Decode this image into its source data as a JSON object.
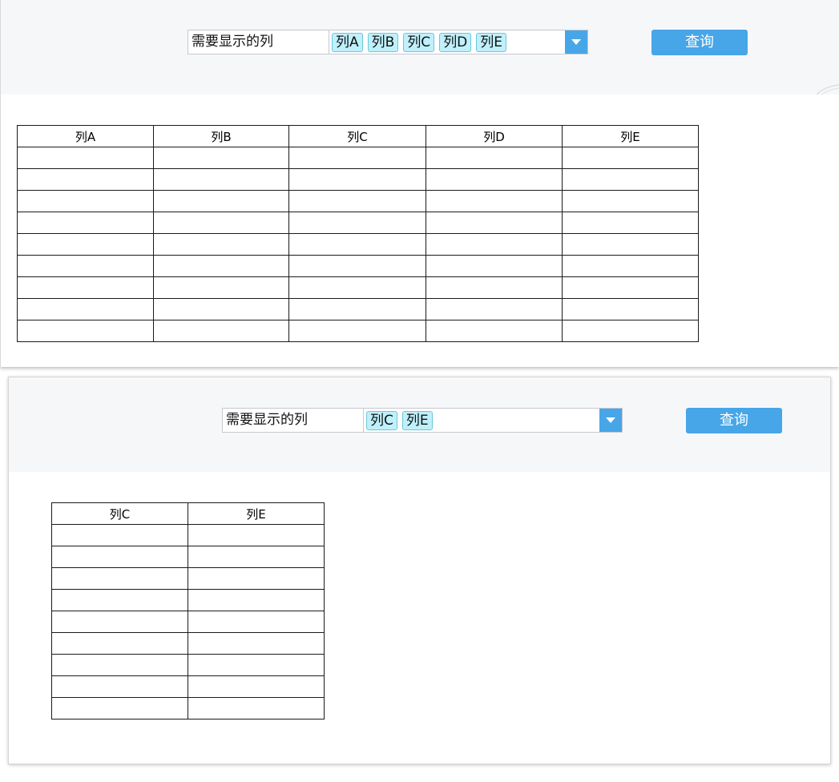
{
  "top": {
    "selector": {
      "label": "需要显示的列",
      "tags": [
        "列A",
        "列B",
        "列C",
        "列D",
        "列E"
      ]
    },
    "query_label": "查询",
    "table": {
      "headers": [
        "列A",
        "列B",
        "列C",
        "列D",
        "列E"
      ],
      "empty_rows": 9
    }
  },
  "bottom": {
    "selector": {
      "label": "需要显示的列",
      "tags": [
        "列C",
        "列E"
      ]
    },
    "query_label": "查询",
    "table": {
      "headers": [
        "列C",
        "列E"
      ],
      "empty_rows": 9
    }
  },
  "icons": {
    "dropdown": "triangle-down-icon"
  },
  "colors": {
    "accent": "#46a6e8",
    "tag_bg": "#bff0fb",
    "tag_border": "#6ec7d8",
    "toolbar_bg": "#f6f7f9"
  }
}
